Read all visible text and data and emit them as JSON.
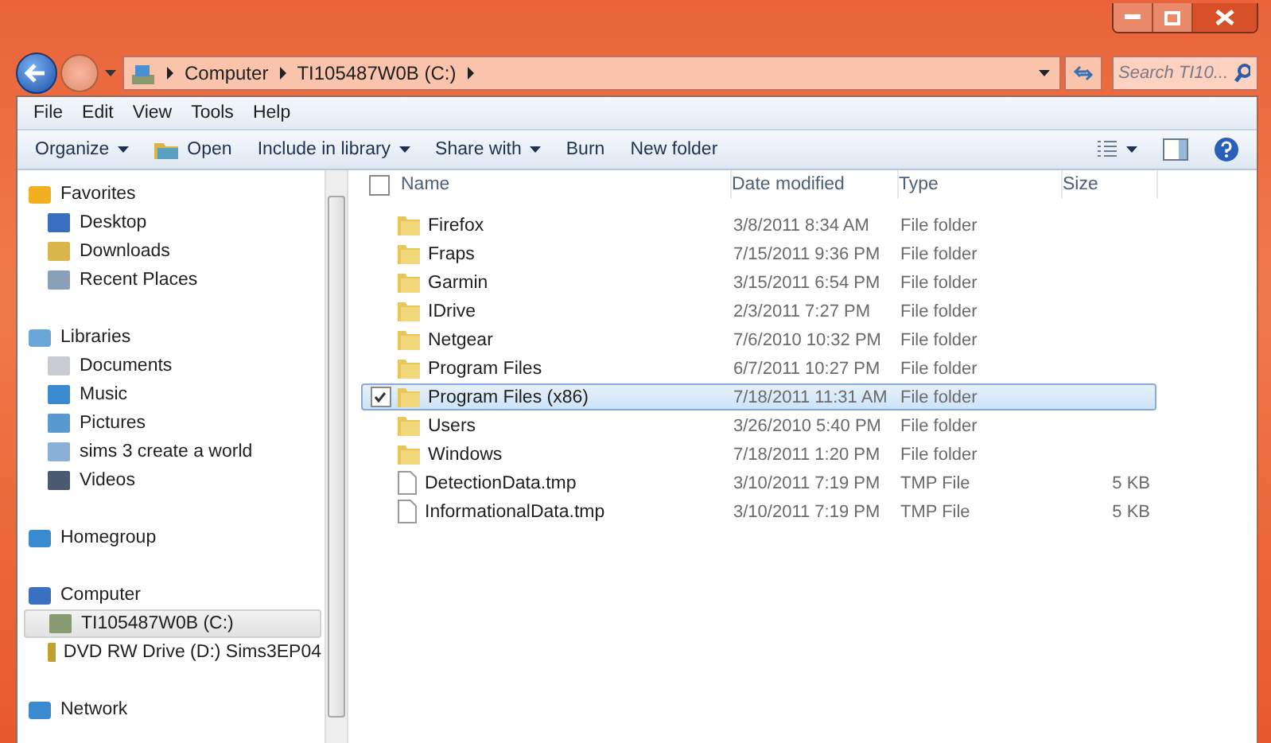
{
  "address": {
    "crumbs": [
      "Computer",
      "TI105487W0B (C:)"
    ]
  },
  "search": {
    "placeholder": "Search TI10..."
  },
  "menu": [
    "File",
    "Edit",
    "View",
    "Tools",
    "Help"
  ],
  "commands": [
    {
      "label": "Organize",
      "kind": "dropdown"
    },
    {
      "label": "Open",
      "kind": "icon"
    },
    {
      "label": "Include in library",
      "kind": "dropdown"
    },
    {
      "label": "Share with",
      "kind": "dropdown"
    },
    {
      "label": "Burn",
      "kind": "plain"
    },
    {
      "label": "New folder",
      "kind": "plain"
    }
  ],
  "sidebar": [
    {
      "label": "Favorites",
      "children": [
        {
          "label": "Desktop",
          "selected": false
        },
        {
          "label": "Downloads",
          "selected": false
        },
        {
          "label": "Recent Places",
          "selected": false
        }
      ]
    },
    {
      "label": "Libraries",
      "children": [
        {
          "label": "Documents",
          "selected": false
        },
        {
          "label": "Music",
          "selected": false
        },
        {
          "label": "Pictures",
          "selected": false
        },
        {
          "label": "sims 3 create a world",
          "selected": false
        },
        {
          "label": "Videos",
          "selected": false
        }
      ]
    },
    {
      "label": "Homegroup"
    },
    {
      "label": "Computer",
      "children": [
        {
          "label": "TI105487W0B (C:)",
          "selected": true
        },
        {
          "label": "DVD RW Drive (D:) Sims3EP04",
          "selected": false
        }
      ]
    },
    {
      "label": "Network"
    }
  ],
  "table": {
    "select_all_checked": false,
    "columns": [
      "Name",
      "Date modified",
      "Type",
      "Size"
    ],
    "rows": [
      {
        "name": "Firefox",
        "date": "3/8/2011 8:34 AM",
        "type": "File folder",
        "kind": "folder",
        "selected": false
      },
      {
        "name": "Fraps",
        "date": "7/15/2011 9:36 PM",
        "type": "File folder",
        "kind": "folder",
        "selected": false
      },
      {
        "name": "Garmin",
        "date": "3/15/2011 6:54 PM",
        "type": "File folder",
        "kind": "folder",
        "selected": false
      },
      {
        "name": "IDrive",
        "date": "2/3/2011 7:27 PM",
        "type": "File folder",
        "kind": "folder",
        "selected": false
      },
      {
        "name": "Netgear",
        "date": "7/6/2010 10:32 PM",
        "type": "File folder",
        "kind": "folder",
        "selected": false
      },
      {
        "name": "Program Files",
        "date": "6/7/2011 10:27 PM",
        "type": "File folder",
        "kind": "folder",
        "selected": false
      },
      {
        "name": "Program Files (x86)",
        "date": "7/18/2011 11:31 AM",
        "type": "File folder",
        "kind": "folder",
        "selected": true
      },
      {
        "name": "Users",
        "date": "3/26/2010 5:40 PM",
        "type": "File folder",
        "kind": "folder",
        "selected": false
      },
      {
        "name": "Windows",
        "date": "7/18/2011 1:20 PM",
        "type": "File folder",
        "kind": "folder",
        "selected": false
      },
      {
        "name": "DetectionData.tmp",
        "date": "3/10/2011 7:19 PM",
        "type": "TMP File",
        "size": "5 KB",
        "kind": "file",
        "selected": false
      },
      {
        "name": "InformationalData.tmp",
        "date": "3/10/2011 7:19 PM",
        "type": "TMP File",
        "size": "5 KB",
        "kind": "file",
        "selected": false
      }
    ]
  }
}
